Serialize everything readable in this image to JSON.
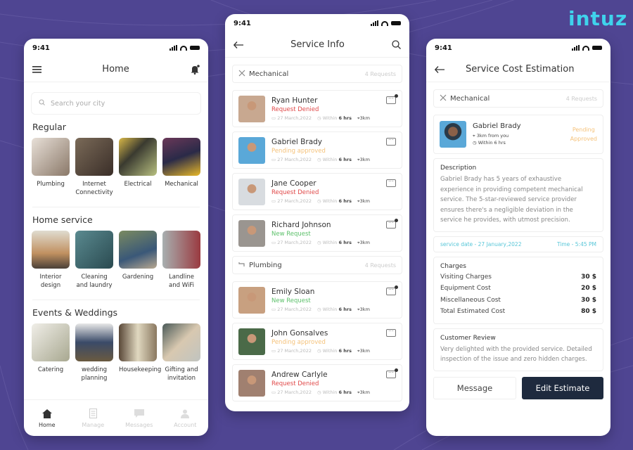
{
  "brand": {
    "logo_text": "intuz",
    "accent": "#3fd3ec",
    "background": "#4f4592"
  },
  "status_bar": {
    "time": "9:41"
  },
  "home": {
    "title": "Home",
    "search_placeholder": "Search your city",
    "sections": [
      {
        "title": "Regular",
        "items": [
          {
            "label": "Plumbing",
            "color": "#c9b8a8"
          },
          {
            "label": "Internet Connectivity",
            "color": "#5a4a3a"
          },
          {
            "label": "Electrical",
            "color": "#4c4a3a"
          },
          {
            "label": "Mechanical",
            "color": "#5a3a4a"
          }
        ]
      },
      {
        "title": "Home service",
        "items": [
          {
            "label": "Interior design",
            "color": "#b8a890"
          },
          {
            "label": "Cleaning and laundry",
            "color": "#3f6a70"
          },
          {
            "label": "Gardening",
            "color": "#5f6a58"
          },
          {
            "label": "Landline and WiFi",
            "color": "#8a4a48"
          }
        ]
      },
      {
        "title": "Events & Weddings",
        "items": [
          {
            "label": "Catering",
            "color": "#d8d2c8"
          },
          {
            "label": "wedding planning",
            "color": "#7a6a60"
          },
          {
            "label": "Housekeeping",
            "color": "#8a7a60"
          },
          {
            "label": "Gifting and invitation",
            "color": "#9aa098"
          }
        ]
      }
    ],
    "tabs": [
      {
        "label": "Home",
        "icon": "home-icon",
        "active": true
      },
      {
        "label": "Manage",
        "icon": "clipboard-icon",
        "active": false
      },
      {
        "label": "Messages",
        "icon": "chat-icon",
        "active": false
      },
      {
        "label": "Account",
        "icon": "user-icon",
        "active": false
      }
    ]
  },
  "service_info": {
    "title": "Service Info",
    "groups": [
      {
        "category": "Mechanical",
        "icon": "tools-icon",
        "count": "4 Requests",
        "requests": [
          {
            "name": "Ryan Hunter",
            "status": "Request Denied",
            "status_color": "#e04848",
            "date": "27 March,2022",
            "within_label": "Within",
            "within": "6 hrs",
            "distance": "3km",
            "unread": true,
            "avatar_color": "#c8a890"
          },
          {
            "name": "Gabriel Brady",
            "status": "Pending approved",
            "status_color": "#f5c27a",
            "date": "27 March,2022",
            "within_label": "Within",
            "within": "6 hrs",
            "distance": "3km",
            "unread": false,
            "avatar_color": "#5aa8d8"
          },
          {
            "name": "Jane Cooper",
            "status": "Request Denied",
            "status_color": "#e04848",
            "date": "27 March,2022",
            "within_label": "Within",
            "within": "6 hrs",
            "distance": "3km",
            "unread": false,
            "avatar_color": "#d8dce0"
          },
          {
            "name": "Richard Johnson",
            "status": "New Request",
            "status_color": "#5cc06a",
            "date": "27 March,2022",
            "within_label": "Within",
            "within": "6 hrs",
            "distance": "3km",
            "unread": true,
            "avatar_color": "#9a9590"
          }
        ]
      },
      {
        "category": "Plumbing",
        "icon": "pipe-icon",
        "count": "4 Requests",
        "requests": [
          {
            "name": "Emily Sloan",
            "status": "New Request",
            "status_color": "#5cc06a",
            "date": "27 March,2022",
            "within_label": "Within",
            "within": "6 hrs",
            "distance": "3km",
            "unread": true,
            "avatar_color": "#c8a080"
          },
          {
            "name": "John Gonsalves",
            "status": "Pending approved",
            "status_color": "#f5c27a",
            "date": "27 March,2022",
            "within_label": "Within",
            "within": "6 hrs",
            "distance": "3km",
            "unread": false,
            "avatar_color": "#4a6a48"
          },
          {
            "name": "Andrew Carlyle",
            "status": "Request Denied",
            "status_color": "#e04848",
            "date": "27 March,2022",
            "within_label": "Within",
            "within": "6 hrs",
            "distance": "3km",
            "unread": true,
            "avatar_color": "#a08070"
          }
        ]
      }
    ]
  },
  "cost": {
    "title": "Service Cost Estimation",
    "category": "Mechanical",
    "count": "4 Requests",
    "provider": {
      "name": "Gabriel Brady",
      "distance": "3km from you",
      "within": "Within 6 hrs",
      "status_line1": "Pending",
      "status_line2": "Approved"
    },
    "description_title": "Description",
    "description": "Gabriel Brady has 5 years of exhaustive experience in providing competent mechanical service. The 5-star-reviewed service provider ensures there's a negligible deviation in the service he provides, with utmost precision.",
    "service_date": "service date - 27 January,2022",
    "service_time": "Time - 5:45 PM",
    "charges_title": "Charges",
    "charges": [
      {
        "label": "Visiting Charges",
        "amount": "30 $"
      },
      {
        "label": "Equipment Cost",
        "amount": "20 $"
      },
      {
        "label": "Miscellaneous Cost",
        "amount": "30 $"
      },
      {
        "label": "Total Estimated Cost",
        "amount": "80 $"
      }
    ],
    "review_title": "Customer Review",
    "review": "Very delighted with the provided service. Detailed inspection of the issue and zero hidden charges.",
    "message_label": "Message",
    "edit_label": "Edit Estimate"
  }
}
